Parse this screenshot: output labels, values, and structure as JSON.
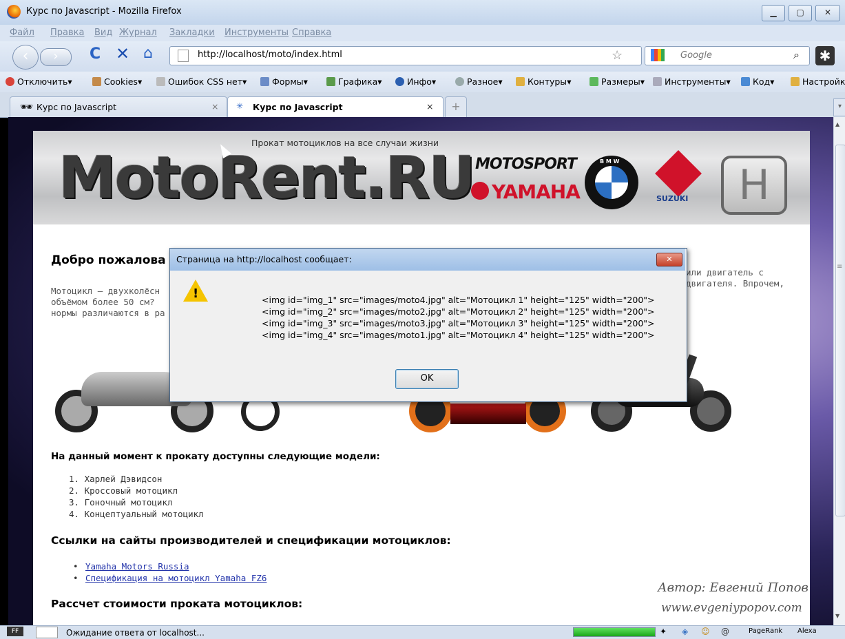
{
  "window": {
    "title": "Курс по Javascript - Mozilla Firefox",
    "min": "▁",
    "max": "▢",
    "close": "✕"
  },
  "menu": [
    "Файл",
    "Правка",
    "Вид",
    "Журнал",
    "Закладки",
    "Инструменты",
    "Справка"
  ],
  "nav": {
    "url": "http://localhost/moto/index.html",
    "search_placeholder": "Google",
    "back": "‹",
    "forward": "›",
    "reload": "C",
    "stop": "✕",
    "home": "⌂"
  },
  "webdev_toolbar": [
    "Отключить",
    "Cookies",
    "Ошибок CSS нет",
    "Формы",
    "Графика",
    "Инфо",
    "Разное",
    "Контуры",
    "Размеры",
    "Инструменты",
    "Код",
    "Настройки"
  ],
  "tabs": [
    {
      "label": "Курс по Javascript"
    },
    {
      "label": "Курс по Javascript"
    }
  ],
  "tab_close": "×",
  "new_tab": "+",
  "page": {
    "tagline": "Прокат мотоциклов на все случаи жизни",
    "logo": "MotoRent.RU",
    "brands": {
      "motosport": "MOTOSPORT",
      "yamaha": "YAMAHA",
      "bmw": "B M W",
      "suzuki": "SUZUKI",
      "honda": "H"
    },
    "welcome": "Добро пожалова",
    "intro_left": [
      "Мотоцикл — двухколёсн",
      "объёмом более 50 см?",
      "нормы различаются в ра"
    ],
    "intro_right": [
      "или двигатель с",
      "двигателя. Впрочем,"
    ],
    "available_heading": "На данный момент к прокату доступны следующие модели:",
    "models": [
      "1. Харлей Дэвидсон",
      "2. Кроссовый мотоцикл",
      "3. Гоночный мотоцикл",
      "4. Концептуальный мотоцикл"
    ],
    "links_heading": "Ссылки на сайты производителей и спецификации мотоциклов:",
    "links": [
      "Yamaha Motors Russia",
      "Спецификация на мотоцикл Yamaha FZ6"
    ],
    "calc_heading": "Рассчет стоимости проката мотоциклов:",
    "author": "Автор: Евгений Попов",
    "author_site": "www.evgeniypopov.com"
  },
  "dialog": {
    "title": "Страница на http://localhost сообщает:",
    "lines": [
      "<img id=\"img_1\" src=\"images/moto4.jpg\" alt=\"Мотоцикл 1\" height=\"125\" width=\"200\">",
      "<img id=\"img_2\" src=\"images/moto2.jpg\" alt=\"Мотоцикл 2\" height=\"125\" width=\"200\">",
      "<img id=\"img_3\" src=\"images/moto3.jpg\" alt=\"Мотоцикл 3\" height=\"125\" width=\"200\">",
      "<img id=\"img_4\" src=\"images/moto1.jpg\" alt=\"Мотоцикл 4\" height=\"125\" width=\"200\">"
    ],
    "ok": "OK",
    "close": "✕",
    "warning_icon": "!"
  },
  "status": {
    "text": "Ожидание ответа от localhost...",
    "progress": 1.0,
    "pagerank": "PageRank",
    "alexa": "Alexa"
  },
  "colors": {
    "accent": "#2233aa",
    "page_bg": "#ffffff"
  }
}
